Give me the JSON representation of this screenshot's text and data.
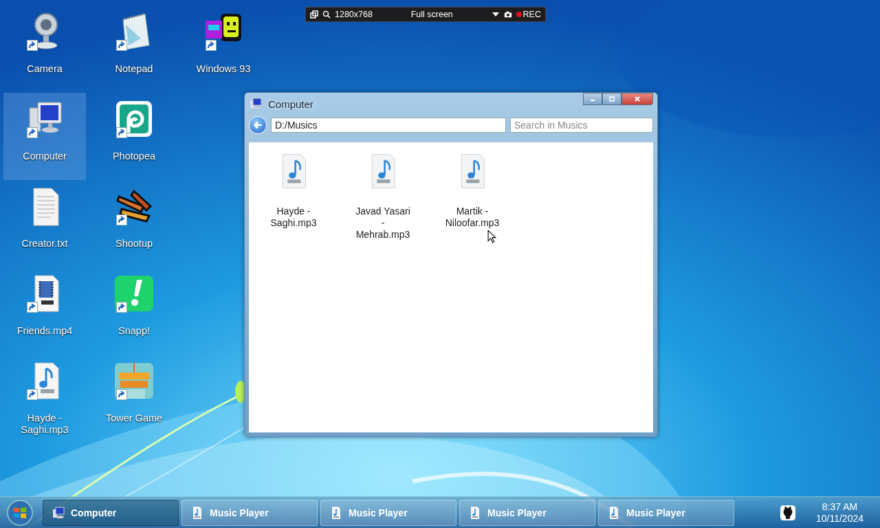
{
  "recorder": {
    "resolution": "1280x768",
    "mode": "Full screen",
    "rec": "REC"
  },
  "desktop_icons": [
    {
      "label": "Camera",
      "kind": "camera",
      "shortcut": true,
      "selected": false
    },
    {
      "label": "Computer",
      "kind": "computer",
      "shortcut": true,
      "selected": true
    },
    {
      "label": "Creator.txt",
      "kind": "text",
      "shortcut": false,
      "selected": false
    },
    {
      "label": "Friends.mp4",
      "kind": "video",
      "shortcut": true,
      "selected": false
    },
    {
      "label": "Hayde - Saghi.mp3",
      "kind": "audio",
      "shortcut": true,
      "selected": false
    },
    {
      "label": "Notepad",
      "kind": "notepad",
      "shortcut": true,
      "selected": false
    },
    {
      "label": "Photopea",
      "kind": "photopea",
      "shortcut": true,
      "selected": false
    },
    {
      "label": "Shootup",
      "kind": "shootup",
      "shortcut": true,
      "selected": false
    },
    {
      "label": "Snapp!",
      "kind": "snap",
      "shortcut": true,
      "selected": false
    },
    {
      "label": "Tower Game",
      "kind": "tower",
      "shortcut": true,
      "selected": false
    },
    {
      "label": "Windows 93",
      "kind": "win93",
      "shortcut": true,
      "selected": false
    }
  ],
  "window": {
    "title": "Computer",
    "path": "D:/Musics",
    "search": {
      "placeholder": "Search in Musics"
    },
    "files": [
      {
        "name": "Hayde - Saghi.mp3"
      },
      {
        "name": "Javad Yasari - Mehrab.mp3"
      },
      {
        "name": "Martik - Niloofar.mp3"
      }
    ]
  },
  "taskbar": {
    "tasks": [
      {
        "label": "Computer",
        "kind": "computer",
        "selected": true
      },
      {
        "label": "Music Player",
        "kind": "audio",
        "selected": false
      },
      {
        "label": "Music Player",
        "kind": "audio",
        "selected": false
      },
      {
        "label": "Music Player",
        "kind": "audio",
        "selected": false
      },
      {
        "label": "Music Player",
        "kind": "audio",
        "selected": false
      }
    ],
    "time": "8:37 AM",
    "date": "10/11/2024"
  }
}
